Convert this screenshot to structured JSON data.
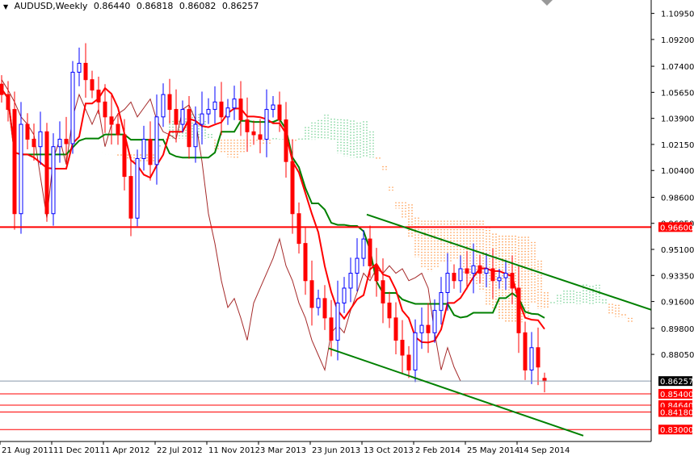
{
  "header": {
    "symbol": "AUDUSD,Weekly",
    "open": "0.86440",
    "high": "0.86818",
    "low": "0.86082",
    "close": "0.86257"
  },
  "colors": {
    "bull_candle": "#0000ff",
    "bear_candle": "#ff0000",
    "tenkan": "#ff0000",
    "kijun": "#008000",
    "chikou": "#a52a2a",
    "cloud_up": "#66cc88",
    "cloud_down": "#ff8c33",
    "trendline": "#008000",
    "level": "#ff0000"
  },
  "chart_data": {
    "type": "candlestick",
    "title": "AUDUSD,Weekly",
    "bar_weeks": 2,
    "ylim": [
      0.822,
      1.1185
    ],
    "y_ticks": [
      "1.10950",
      "1.09200",
      "1.07400",
      "1.05650",
      "1.03900",
      "1.02150",
      "1.00400",
      "0.98600",
      "0.96850",
      "0.95100",
      "0.93350",
      "0.91600",
      "0.89800",
      "0.88050"
    ],
    "x_ticks": [
      "21 Aug 2011",
      "11 Dec 2011",
      "1 Apr 2012",
      "22 Jul 2012",
      "11 Nov 2012",
      "3 Mar 2013",
      "23 Jun 2013",
      "13 Oct 2013",
      "2 Feb 2014",
      "25 May 2014",
      "14 Sep 2014"
    ],
    "x_tick_bar_step": 8,
    "closes": [
      1.055,
      1.045,
      0.975,
      1.035,
      1.025,
      1.02,
      1.03,
      0.975,
      1.02,
      1.025,
      1.022,
      1.07,
      1.076,
      1.065,
      1.058,
      1.05,
      1.04,
      1.035,
      1.028,
      1.0,
      0.972,
      1.012,
      1.025,
      1.008,
      1.04,
      1.055,
      1.045,
      1.035,
      1.045,
      1.02,
      1.035,
      1.042,
      1.045,
      1.05,
      1.04,
      1.046,
      1.052,
      1.038,
      1.03,
      1.028,
      1.025,
      1.045,
      1.048,
      1.038,
      1.01,
      0.975,
      0.955,
      0.93,
      0.912,
      0.918,
      0.905,
      0.89,
      0.915,
      0.925,
      0.935,
      0.945,
      0.958,
      0.94,
      0.93,
      0.915,
      0.905,
      0.89,
      0.88,
      0.87,
      0.895,
      0.9,
      0.895,
      0.91,
      0.922,
      0.935,
      0.93,
      0.938,
      0.935,
      0.94,
      0.935,
      0.938,
      0.93,
      0.932,
      0.935,
      0.925,
      0.895,
      0.87,
      0.885,
      0.872,
      0.86257
    ],
    "first_open": 1.062,
    "indicator": {
      "name": "Ichimoku",
      "tenkan": 5,
      "kijun": 13,
      "senkou_b": 26,
      "shift": 13
    },
    "trendlines": [
      {
        "name": "upper-channel",
        "points": [
          [
            56.5,
            0.9744
          ],
          [
            100.6,
            0.9103
          ]
        ]
      },
      {
        "name": "lower-channel",
        "points": [
          [
            50.6,
            0.8846
          ],
          [
            90,
            0.8259
          ]
        ]
      }
    ],
    "levels": [
      {
        "value": 0.966,
        "label": "0.96600"
      },
      {
        "value": 0.854,
        "label": "0.85400"
      },
      {
        "value": 0.8464,
        "label": "0.84640"
      },
      {
        "value": 0.8418,
        "label": "0.84180"
      },
      {
        "value": 0.83,
        "label": "0.83000"
      }
    ],
    "current_price": {
      "value": 0.86257,
      "label": "0.86257"
    }
  }
}
